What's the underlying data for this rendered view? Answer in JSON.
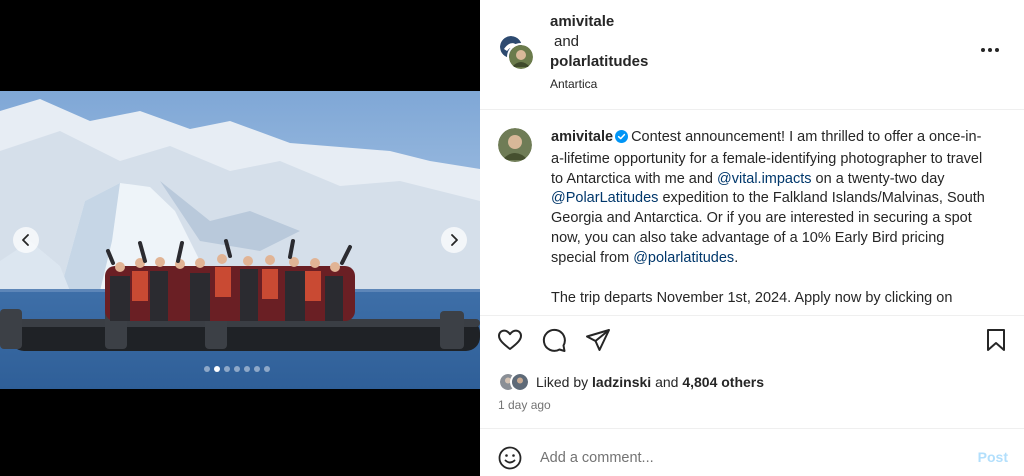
{
  "header": {
    "user1": "amivitale",
    "and": "and",
    "user2": "polarlatitudes",
    "location": "Antartica"
  },
  "caption": {
    "username": "amivitale",
    "t1": "Contest announcement! I am thrilled to offer a once-in-a-lifetime opportunity for a female-identifying photographer to travel to Antarctica with me and ",
    "m1": "@vital.impacts",
    "t2": " on a twenty-two day ",
    "m2": "@PolarLatitudes",
    "t3": " expedition to the Falkland Islands/Malvinas, South Georgia and Antarctica. Or if you are interested in securing a spot now, you can also take advantage of a 10% Early Bird pricing special from ",
    "m3": "@polarlatitudes",
    "t4": ".",
    "p2": "The trip departs November 1st, 2024. Apply now by clicking on"
  },
  "likes": {
    "prefix": "Liked by",
    "user": "ladzinski",
    "and": "and",
    "others": "4,804 others"
  },
  "time_ago": "1 day ago",
  "comment": {
    "placeholder": "Add a comment...",
    "post_label": "Post"
  },
  "carousel": {
    "total": 7,
    "active_index": 1
  },
  "icons": {
    "prev": "chevron-left-icon",
    "next": "chevron-right-icon",
    "more": "more-horizontal-icon",
    "like": "heart-icon",
    "comment": "comment-icon",
    "share": "send-icon",
    "save": "bookmark-icon",
    "emoji": "emoji-icon",
    "verified": "verified-badge-icon"
  },
  "colors": {
    "mention": "#00376b",
    "verified": "#0095f6",
    "post_disabled": "#b2dffc",
    "secondary_text": "#737373"
  }
}
